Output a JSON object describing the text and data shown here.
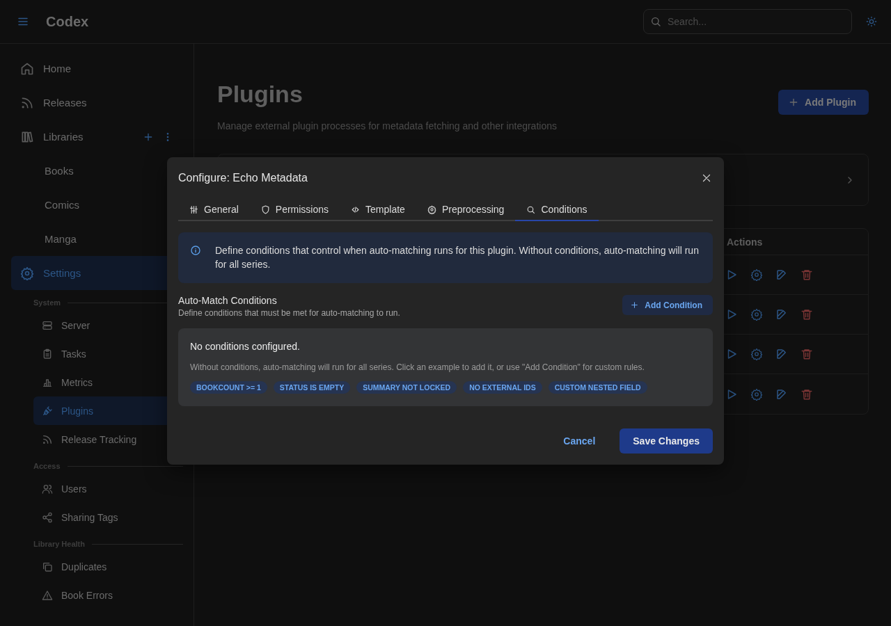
{
  "app": {
    "title": "Codex"
  },
  "search": {
    "placeholder": "Search..."
  },
  "sidebar": {
    "items": [
      {
        "kind": "link",
        "label": "Home",
        "selected": false
      },
      {
        "kind": "link",
        "label": "Releases",
        "selected": false
      },
      {
        "kind": "group",
        "label": "Libraries",
        "selected": false,
        "children": [
          {
            "label": "Books",
            "selected": false
          },
          {
            "label": "Comics",
            "selected": false
          },
          {
            "label": "Manga",
            "selected": false
          }
        ]
      },
      {
        "kind": "settings",
        "label": "Settings",
        "selected": true,
        "sections": [
          {
            "title": "System",
            "items": [
              {
                "label": "Server",
                "selected": false
              },
              {
                "label": "Tasks",
                "selected": false
              },
              {
                "label": "Metrics",
                "selected": false
              },
              {
                "label": "Plugins",
                "selected": true
              },
              {
                "label": "Release Tracking",
                "selected": false
              }
            ]
          },
          {
            "title": "Access",
            "items": [
              {
                "label": "Users",
                "selected": false
              },
              {
                "label": "Sharing Tags",
                "selected": false
              }
            ]
          },
          {
            "title": "Library Health",
            "items": [
              {
                "label": "Duplicates",
                "selected": false
              },
              {
                "label": "Book Errors",
                "selected": false
              }
            ]
          }
        ]
      }
    ]
  },
  "page": {
    "title": "Plugins",
    "subtitle": "Manage external plugin processes for metadata fetching and other integrations",
    "add_button": "Add Plugin",
    "panel": {
      "expanded": false
    },
    "table": {
      "columns": [
        "Actions"
      ],
      "rows": [
        {
          "kind": "actions"
        },
        {
          "kind": "actions"
        },
        {
          "kind": "actions"
        },
        {
          "kind": "actions"
        }
      ]
    }
  },
  "dialog": {
    "title": "Configure: Echo Metadata",
    "tabs": [
      {
        "label": "General",
        "selected": false
      },
      {
        "label": "Permissions",
        "selected": false
      },
      {
        "label": "Template",
        "selected": false
      },
      {
        "label": "Preprocessing",
        "selected": false
      },
      {
        "label": "Conditions",
        "selected": true
      }
    ],
    "info": "Define conditions that control when auto-matching runs for this plugin. Without conditions, auto-matching will run for all series.",
    "section": {
      "title": "Auto-Match Conditions",
      "subtitle": "Define conditions that must be met for auto-matching to run.",
      "add_button": "Add Condition"
    },
    "empty": {
      "title": "No conditions configured.",
      "description": "Without conditions, auto-matching will run for all series. Click an example to add it, or use \"Add Condition\" for custom rules.",
      "examples": [
        "BOOKCOUNT >= 1",
        "STATUS IS EMPTY",
        "SUMMARY NOT LOCKED",
        "NO EXTERNAL IDS",
        "CUSTOM NESTED FIELD"
      ]
    },
    "buttons": {
      "cancel": "Cancel",
      "save": "Save Changes"
    }
  }
}
